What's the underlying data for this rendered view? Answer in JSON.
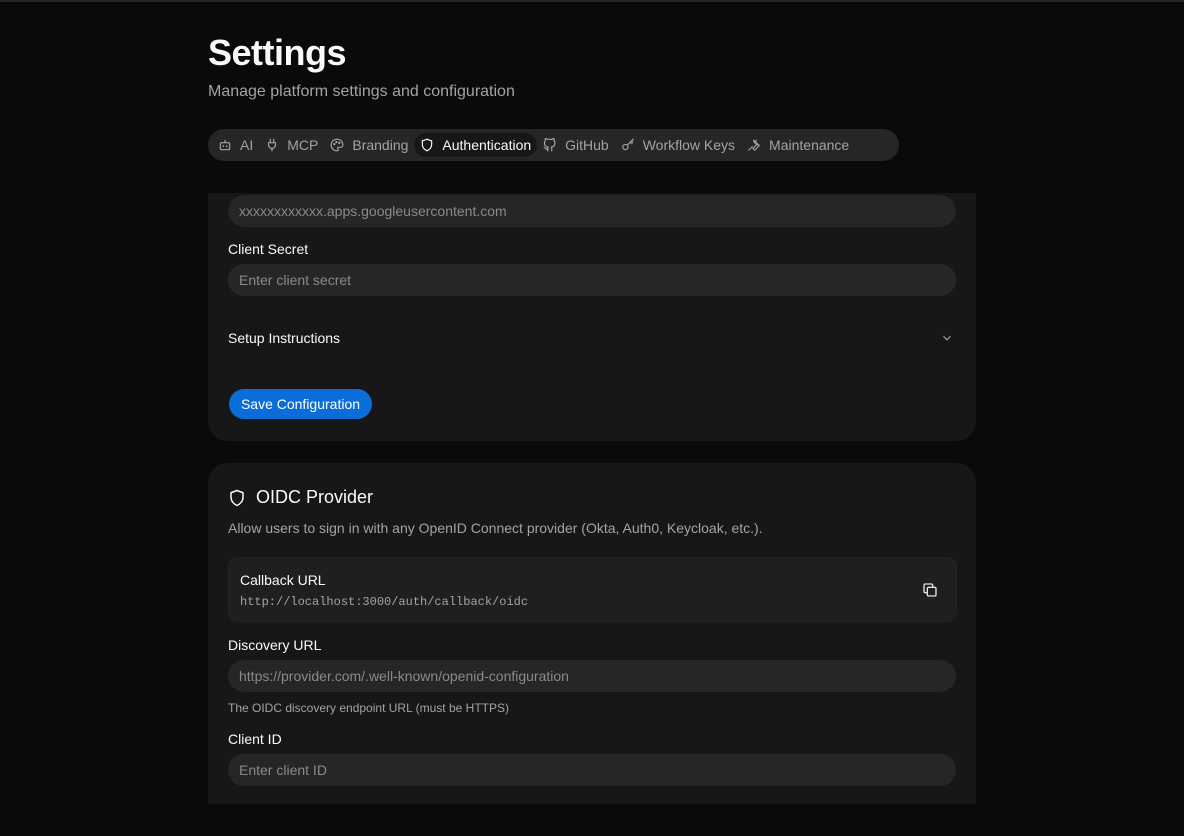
{
  "page": {
    "title": "Settings",
    "subtitle": "Manage platform settings and configuration"
  },
  "tabs": [
    {
      "label": "AI",
      "icon": "bot-icon",
      "active": false
    },
    {
      "label": "MCP",
      "icon": "plug-icon",
      "active": false
    },
    {
      "label": "Branding",
      "icon": "palette-icon",
      "active": false
    },
    {
      "label": "Authentication",
      "icon": "shield-icon",
      "active": true
    },
    {
      "label": "GitHub",
      "icon": "github-icon",
      "active": false
    },
    {
      "label": "Workflow Keys",
      "icon": "key-icon",
      "active": false
    },
    {
      "label": "Maintenance",
      "icon": "wrench-icon",
      "active": false
    }
  ],
  "google": {
    "client_id_placeholder": "xxxxxxxxxxxx.apps.googleusercontent.com",
    "client_secret_label": "Client Secret",
    "client_secret_placeholder": "Enter client secret",
    "setup_instructions_label": "Setup Instructions",
    "save_label": "Save Configuration"
  },
  "oidc": {
    "title": "OIDC Provider",
    "description": "Allow users to sign in with any OpenID Connect provider (Okta, Auth0, Keycloak, etc.).",
    "callback_label": "Callback URL",
    "callback_url": "http://localhost:3000/auth/callback/oidc",
    "discovery_label": "Discovery URL",
    "discovery_placeholder": "https://provider.com/.well-known/openid-configuration",
    "discovery_hint": "The OIDC discovery endpoint URL (must be HTTPS)",
    "client_id_label": "Client ID",
    "client_id_placeholder": "Enter client ID"
  },
  "colors": {
    "background": "#0a0a0a",
    "card": "#171717",
    "input": "#262626",
    "primary": "#0a6dd9"
  }
}
